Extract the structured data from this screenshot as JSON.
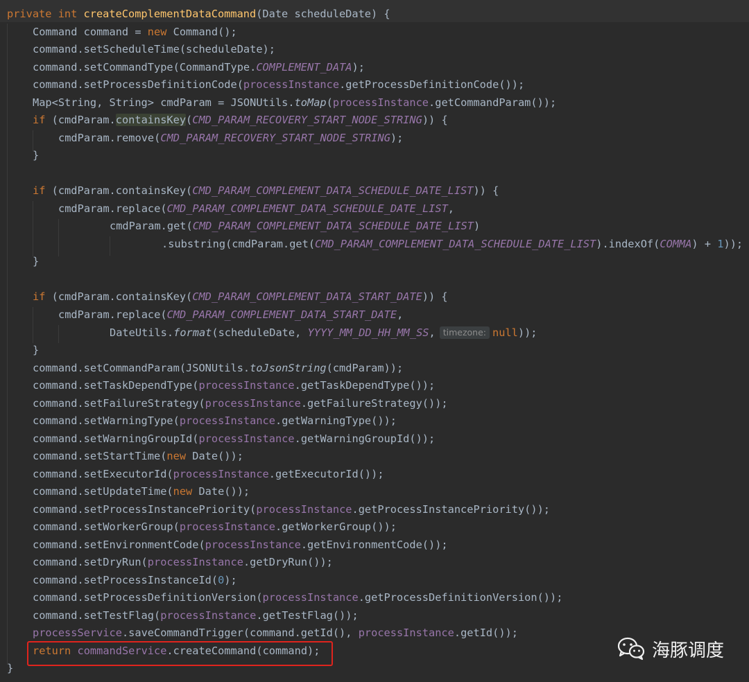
{
  "code": {
    "l1": [
      "private",
      "int",
      "createComplementDataCommand",
      "(Date scheduleDate) {"
    ],
    "l2": [
      "Command command = ",
      "new",
      " Command();"
    ],
    "l3": [
      "command.setScheduleTime(scheduleDate);"
    ],
    "l4": [
      "command.setCommandType(CommandType.",
      "COMPLEMENT_DATA",
      ");"
    ],
    "l5": [
      "command.setProcessDefinitionCode(",
      "processInstance",
      ".getProcessDefinitionCode());"
    ],
    "l6": [
      "Map<String, String> cmdParam = JSONUtils.",
      "toMap",
      "(",
      "processInstance",
      ".getCommandParam());"
    ],
    "l7": [
      "if",
      " (cmdParam.",
      "containsKey",
      "(",
      "CMD_PARAM_RECOVERY_START_NODE_STRING",
      ")) {"
    ],
    "l8": [
      "cmdParam.remove(",
      "CMD_PARAM_RECOVERY_START_NODE_STRING",
      ");"
    ],
    "l9": [
      "}"
    ],
    "l11": [
      "if",
      " (cmdParam.containsKey(",
      "CMD_PARAM_COMPLEMENT_DATA_SCHEDULE_DATE_LIST",
      ")) {"
    ],
    "l12": [
      "cmdParam.replace(",
      "CMD_PARAM_COMPLEMENT_DATA_SCHEDULE_DATE_LIST",
      ","
    ],
    "l13": [
      "cmdParam.get(",
      "CMD_PARAM_COMPLEMENT_DATA_SCHEDULE_DATE_LIST",
      ")"
    ],
    "l14": [
      ".substring(cmdParam.get(",
      "CMD_PARAM_COMPLEMENT_DATA_SCHEDULE_DATE_LIST",
      ").indexOf(",
      "COMMA",
      ") + ",
      "1",
      "));"
    ],
    "l15": [
      "}"
    ],
    "l17": [
      "if",
      " (cmdParam.containsKey(",
      "CMD_PARAM_COMPLEMENT_DATA_START_DATE",
      ")) {"
    ],
    "l18": [
      "cmdParam.replace(",
      "CMD_PARAM_COMPLEMENT_DATA_START_DATE",
      ","
    ],
    "l19": [
      "DateUtils.",
      "format",
      "(scheduleDate, ",
      "YYYY_MM_DD_HH_MM_SS",
      ",",
      "timezone:",
      "null",
      "));"
    ],
    "l20": [
      "}"
    ],
    "l21": [
      "command.setCommandParam(JSONUtils.",
      "toJsonString",
      "(cmdParam));"
    ],
    "l22": [
      "command.setTaskDependType(",
      "processInstance",
      ".getTaskDependType());"
    ],
    "l23": [
      "command.setFailureStrategy(",
      "processInstance",
      ".getFailureStrategy());"
    ],
    "l24": [
      "command.setWarningType(",
      "processInstance",
      ".getWarningType());"
    ],
    "l25": [
      "command.setWarningGroupId(",
      "processInstance",
      ".getWarningGroupId());"
    ],
    "l26": [
      "command.setStartTime(",
      "new",
      " Date());"
    ],
    "l27": [
      "command.setExecutorId(",
      "processInstance",
      ".getExecutorId());"
    ],
    "l28": [
      "command.setUpdateTime(",
      "new",
      " Date());"
    ],
    "l29": [
      "command.setProcessInstancePriority(",
      "processInstance",
      ".getProcessInstancePriority());"
    ],
    "l30": [
      "command.setWorkerGroup(",
      "processInstance",
      ".getWorkerGroup());"
    ],
    "l31": [
      "command.setEnvironmentCode(",
      "processInstance",
      ".getEnvironmentCode());"
    ],
    "l32": [
      "command.setDryRun(",
      "processInstance",
      ".getDryRun());"
    ],
    "l33": [
      "command.setProcessInstanceId(",
      "0",
      ");"
    ],
    "l34": [
      "command.setProcessDefinitionVersion(",
      "processInstance",
      ".getProcessDefinitionVersion());"
    ],
    "l35": [
      "command.setTestFlag(",
      "processInstance",
      ".getTestFlag());"
    ],
    "l36": [
      "processService",
      ".saveCommandTrigger(command.getId(), ",
      "processInstance",
      ".getId());"
    ],
    "l37": [
      "return",
      "commandService",
      ".createCommand(command);"
    ],
    "l38": [
      "}"
    ]
  },
  "watermark": {
    "text": "海豚调度",
    "icon": "wechat-icon"
  },
  "colors": {
    "background": "#2b2b2b",
    "keyword": "#cc7832",
    "method_decl": "#ffc66d",
    "field": "#9876aa",
    "number": "#6897bb",
    "text": "#a9b7c6",
    "highlight_box": "#e0241d"
  }
}
